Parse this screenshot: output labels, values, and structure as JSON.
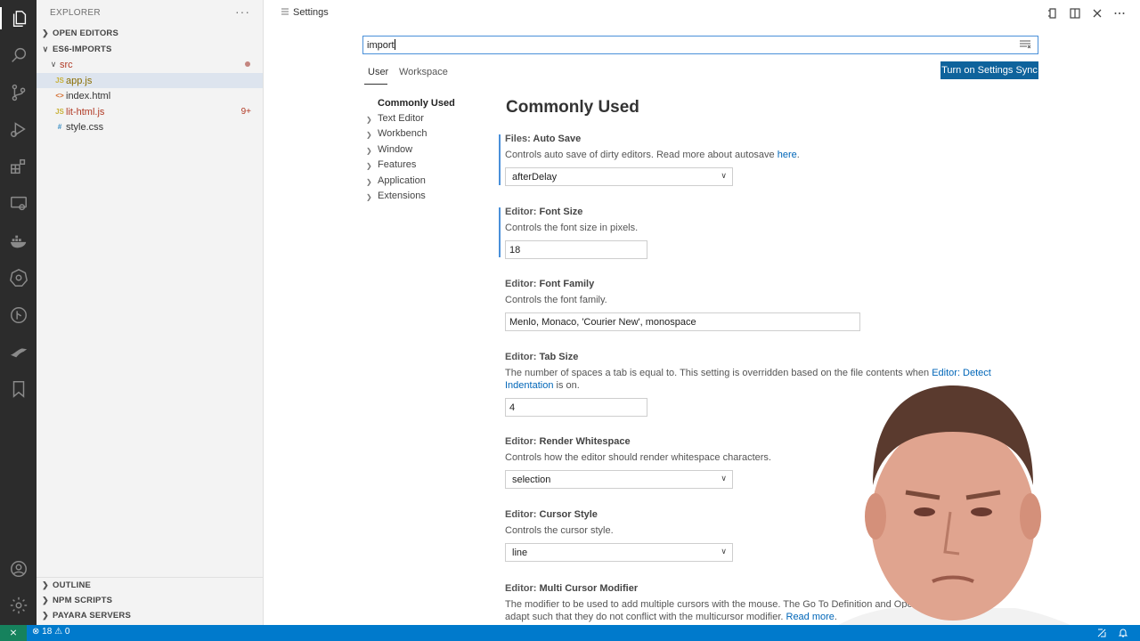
{
  "activity_bar": {
    "icons": [
      "files-icon",
      "search-icon",
      "source-control-icon",
      "run-debug-icon",
      "extensions-icon",
      "remote-explorer-icon",
      "docker-icon",
      "kubernetes-icon",
      "git-graph-icon",
      "deploy-icon",
      "bookmark-icon",
      "account-icon",
      "settings-gear-icon"
    ]
  },
  "sidebar": {
    "title": "EXPLORER",
    "more": "···",
    "sections": {
      "open_editors": "OPEN EDITORS",
      "project": "ES6-IMPORTS",
      "outline": "OUTLINE",
      "npm_scripts": "NPM SCRIPTS",
      "payara": "PAYARA SERVERS"
    },
    "tree": {
      "folder": "src",
      "files": [
        {
          "name": "app.js",
          "icon_text": "JS",
          "badge": ""
        },
        {
          "name": "index.html",
          "icon_text": "<>",
          "badge": ""
        },
        {
          "name": "lit-html.js",
          "icon_text": "JS",
          "badge": "9+"
        },
        {
          "name": "style.css",
          "icon_text": "#",
          "badge": ""
        }
      ]
    }
  },
  "editor": {
    "tab_title": "Settings",
    "search": {
      "value": "import"
    },
    "scopes": {
      "user": "User",
      "workspace": "Workspace"
    },
    "sync_button": "Turn on Settings Sync",
    "toc": [
      "Commonly Used",
      "Text Editor",
      "Workbench",
      "Window",
      "Features",
      "Application",
      "Extensions"
    ],
    "section_title": "Commonly Used",
    "settings": [
      {
        "category": "Files: ",
        "name": "Auto Save",
        "desc": "Controls auto save of dirty editors. Read more about autosave ",
        "link": "here",
        "desc_end": ".",
        "value": "afterDelay"
      },
      {
        "category": "Editor: ",
        "name": "Font Size",
        "desc": "Controls the font size in pixels.",
        "value": "18"
      },
      {
        "category": "Editor: ",
        "name": "Font Family",
        "desc": "Controls the font family.",
        "value": "Menlo, Monaco, 'Courier New', monospace"
      },
      {
        "category": "Editor: ",
        "name": "Tab Size",
        "desc": "The number of spaces a tab is equal to. This setting is overridden based on the file contents when ",
        "link": "Editor: Detect Indentation",
        "desc_end": " is on.",
        "value": "4"
      },
      {
        "category": "Editor: ",
        "name": "Render Whitespace",
        "desc": "Controls how the editor should render whitespace characters.",
        "value": "selection"
      },
      {
        "category": "Editor: ",
        "name": "Cursor Style",
        "desc": "Controls the cursor style.",
        "value": "line"
      },
      {
        "category": "Editor: ",
        "name": "Multi Cursor Modifier",
        "desc": "The modifier to be used to add multiple cursors with the mouse. The Go To Definition and Ope",
        "desc2": "adapt such that they do not conflict with the multicursor modifier. ",
        "link": "Read more",
        "desc_end": "."
      }
    ]
  },
  "statusbar": {
    "errors": "18",
    "warnings": "0"
  },
  "colors": {
    "activity_bg": "#2c2c2c",
    "sidebar_bg": "#f3f3f3",
    "accent": "#0e639c",
    "statusbar": "#007acc"
  }
}
